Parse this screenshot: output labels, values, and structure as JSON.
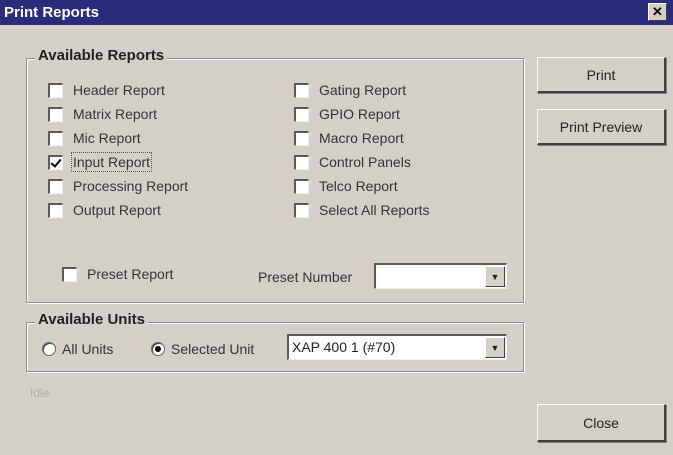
{
  "window": {
    "title": "Print Reports",
    "close_symbol": "✕"
  },
  "reports_group": {
    "label": "Available Reports",
    "left_items": [
      {
        "label": "Header Report",
        "checked": false
      },
      {
        "label": "Matrix Report",
        "checked": false
      },
      {
        "label": "Mic Report",
        "checked": false
      },
      {
        "label": "Input Report",
        "checked": true
      },
      {
        "label": "Processing Report",
        "checked": false
      },
      {
        "label": "Output Report",
        "checked": false
      }
    ],
    "right_items": [
      {
        "label": "Gating Report",
        "checked": false
      },
      {
        "label": "GPIO Report",
        "checked": false
      },
      {
        "label": "Macro Report",
        "checked": false
      },
      {
        "label": "Control Panels",
        "checked": false
      },
      {
        "label": "Telco Report",
        "checked": false
      },
      {
        "label": "Select All Reports",
        "checked": false
      }
    ],
    "preset_report_label": "Preset Report",
    "preset_number_label": "Preset Number",
    "preset_number_value": ""
  },
  "units_group": {
    "label": "Available Units",
    "all_units_label": "All Units",
    "selected_unit_label": "Selected Unit",
    "selected": "selected_unit",
    "unit_value": "XAP 400 1 (#70)"
  },
  "buttons": {
    "print": "Print",
    "print_preview": "Print Preview",
    "close": "Close"
  },
  "status_text": "Idle"
}
